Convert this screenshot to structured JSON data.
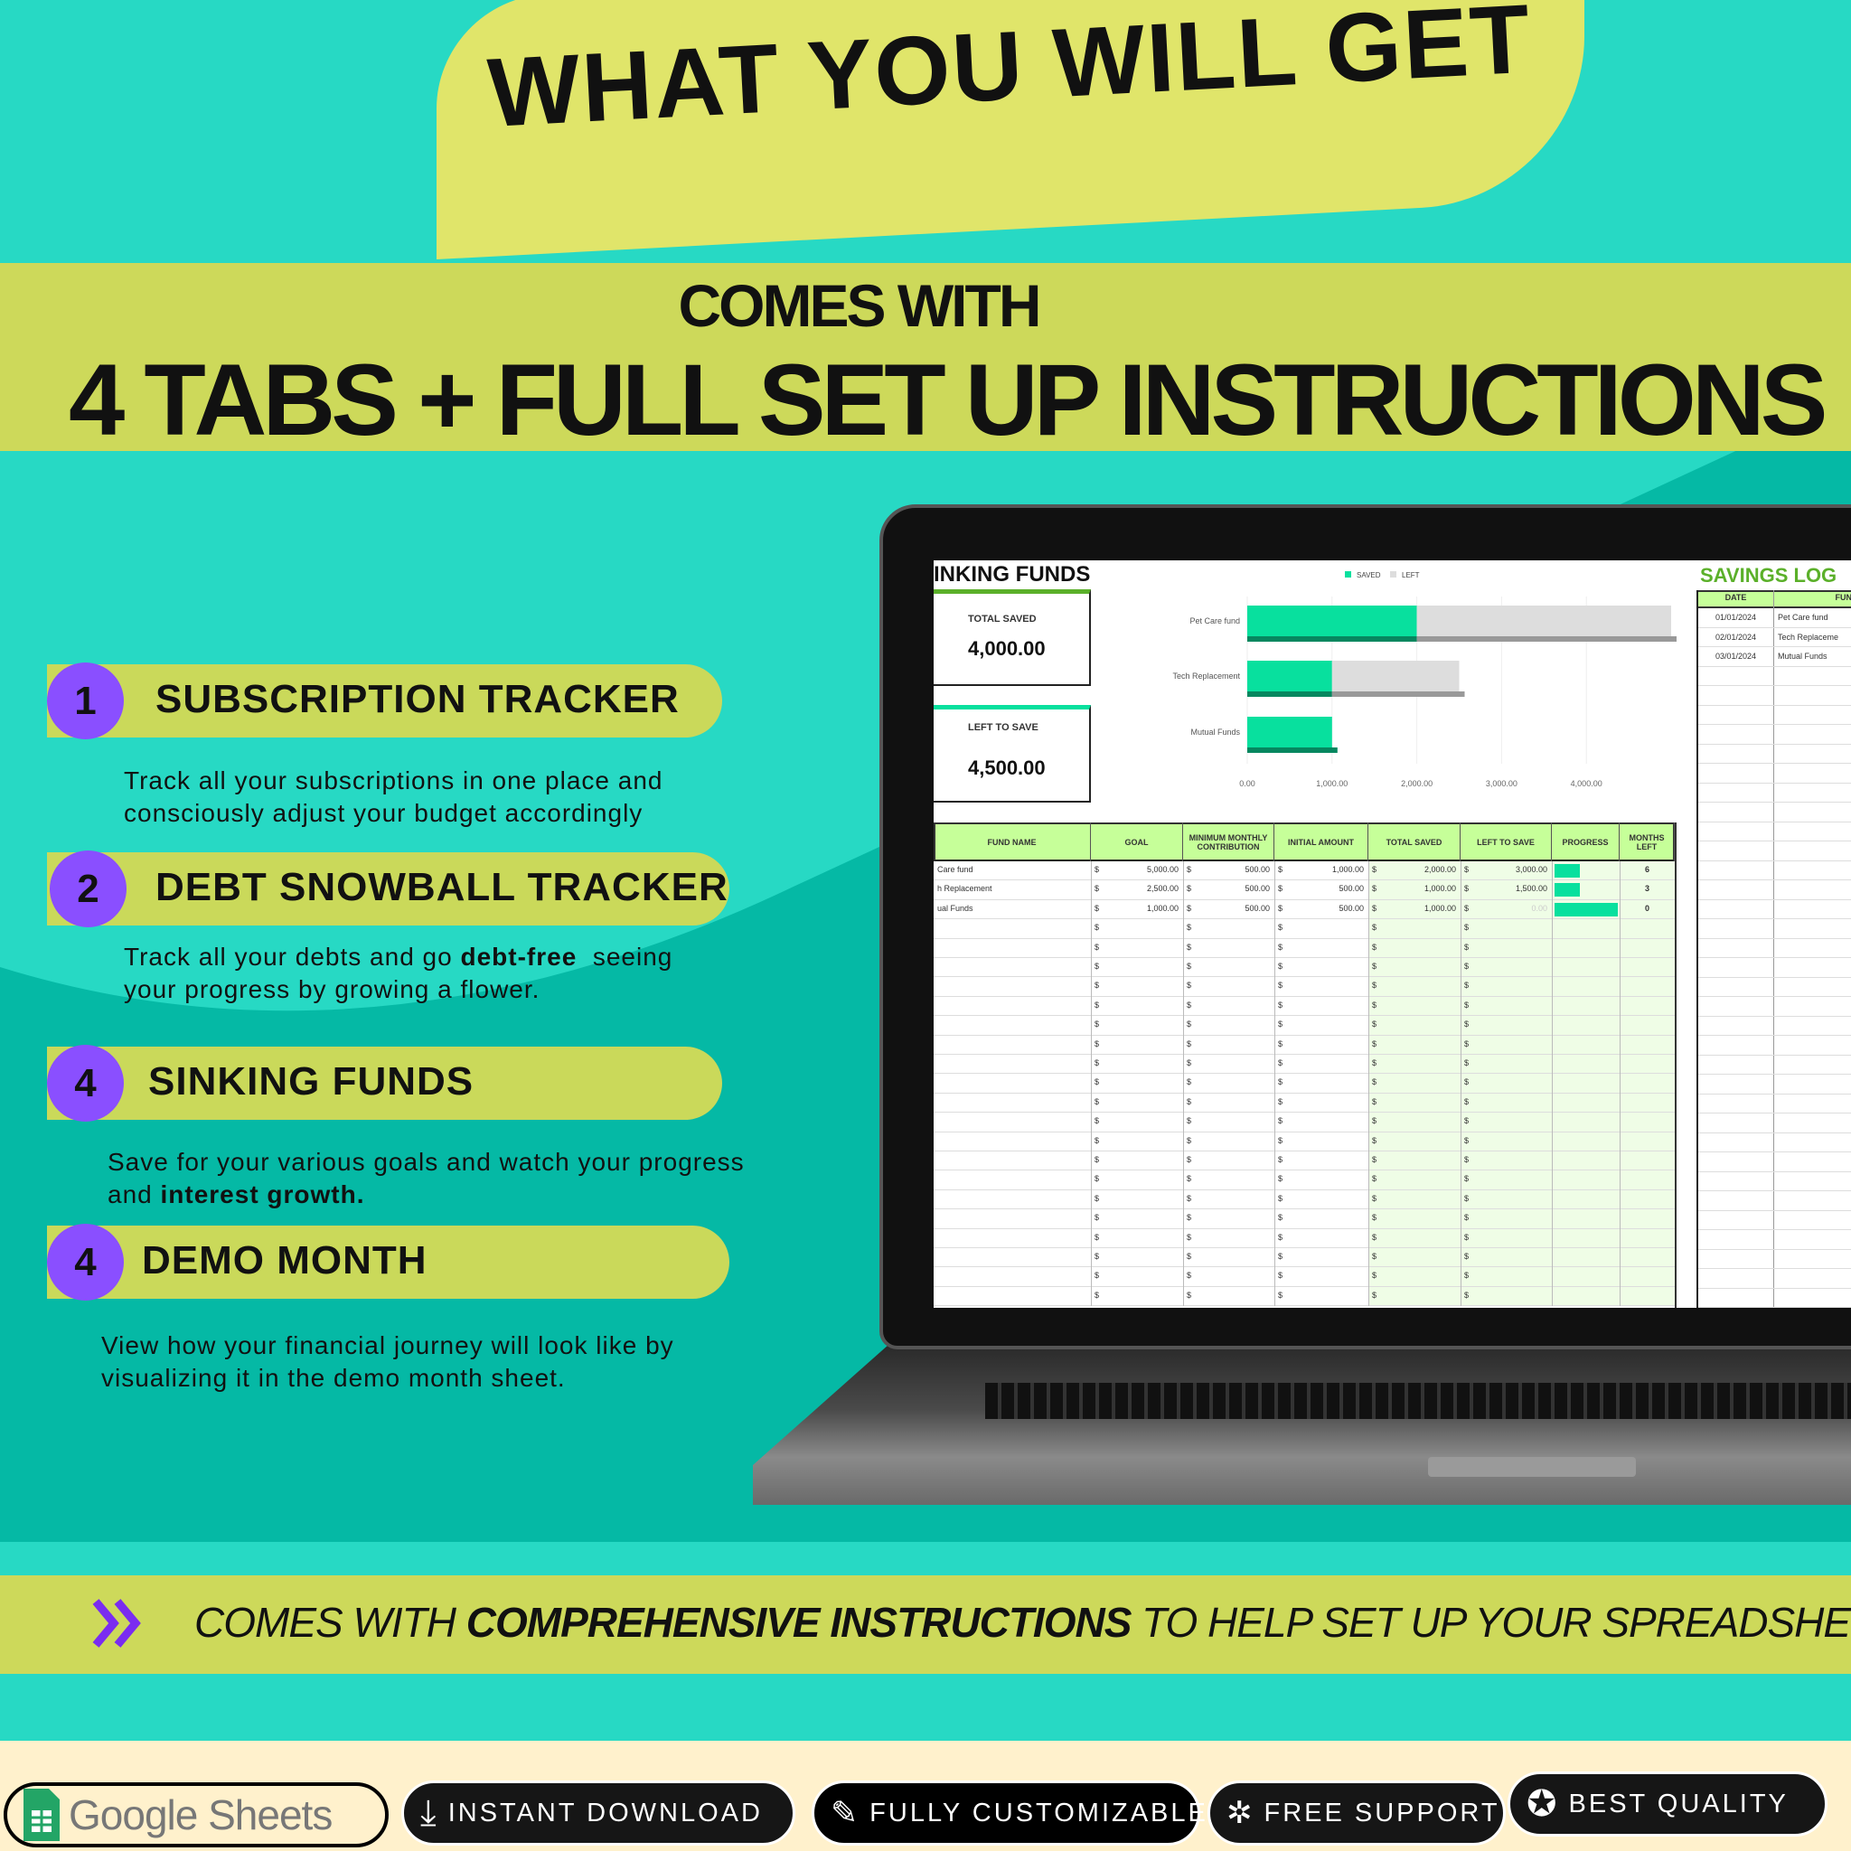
{
  "header": {
    "title": "WHAT YOU WILL GET",
    "subtitle": "COMES WITH",
    "headline": "4 TABS + FULL SET UP INSTRUCTIONS"
  },
  "features": [
    {
      "num": "1",
      "title": "SUBSCRIPTION TRACKER",
      "desc": [
        "Track all your subscriptions in one place and",
        "consciously adjust your budget accordingly"
      ]
    },
    {
      "num": "2",
      "title": "DEBT SNOWBALL TRACKER",
      "desc_pre": "Track all your debts and go ",
      "desc_bold": "debt-free",
      "desc_post": "  seeing",
      "desc2": "your progress by growing a flower."
    },
    {
      "num": "4",
      "title": "SINKING FUNDS",
      "desc": "Save for your various goals and watch your progress",
      "desc2_pre": "and ",
      "desc2_bold": "interest growth."
    },
    {
      "num": "4",
      "title": "DEMO MONTH",
      "desc": [
        "View how your financial journey will look like by",
        "visualizing it in the demo month sheet."
      ]
    }
  ],
  "sheet": {
    "title": "INKING FUNDS",
    "total_saved_label": "TOTAL SAVED",
    "total_saved": "4,000.00",
    "left_label": "LEFT TO SAVE",
    "left": "4,500.00",
    "headers": [
      "FUND NAME",
      "GOAL",
      "MINIMUM MONTHLY CONTRIBUTION",
      "INITIAL AMOUNT",
      "TOTAL SAVED",
      "LEFT TO SAVE",
      "PROGRESS",
      "MONTHS LEFT"
    ],
    "rows": [
      {
        "name": "Care fund",
        "goal": "5,000.00",
        "min": "500.00",
        "init": "1,000.00",
        "saved": "2,000.00",
        "left": "3,000.00",
        "progress": 0.4,
        "months": "6"
      },
      {
        "name": "h Replacement",
        "goal": "2,500.00",
        "min": "500.00",
        "init": "500.00",
        "saved": "1,000.00",
        "left": "1,500.00",
        "progress": 0.4,
        "months": "3"
      },
      {
        "name": "ual Funds",
        "goal": "1,000.00",
        "min": "500.00",
        "init": "500.00",
        "saved": "1,000.00",
        "left": "0.00",
        "progress": 1.0,
        "months": "0"
      }
    ],
    "currency": "$",
    "log_title": "SAVINGS LOG",
    "log_headers": [
      "DATE",
      "FUN"
    ],
    "log_rows": [
      [
        "01/01/2024",
        "Pet Care fund"
      ],
      [
        "02/01/2024",
        "Tech Replaceme"
      ],
      [
        "03/01/2024",
        "Mutual Funds"
      ]
    ]
  },
  "chart_data": {
    "type": "bar",
    "orientation": "horizontal",
    "stacked": true,
    "categories": [
      "Pet Care fund",
      "Tech Replacement",
      "Mutual Funds"
    ],
    "series": [
      {
        "name": "SAVED",
        "values": [
          2000,
          1000,
          1000
        ],
        "color": "#08e09e"
      },
      {
        "name": "LEFT",
        "values": [
          3000,
          1500,
          0
        ],
        "color": "#dddddd"
      }
    ],
    "xticks": [
      "0.00",
      "1,000.00",
      "2,000.00",
      "3,000.00",
      "4,000.00"
    ],
    "xlim": [
      0,
      5000
    ],
    "legend": "top"
  },
  "footer": {
    "pre": "COMES WITH ",
    "bold": "COMPREHENSIVE INSTRUCTIONS",
    "post": " TO HELP SET UP YOUR SPREADSHEET!"
  },
  "badges": {
    "sheets": "Google Sheets",
    "download": "INSTANT DOWNLOAD",
    "custom": "FULLY CUSTOMIZABLE",
    "support": "FREE SUPPORT",
    "quality": "BEST QUALITY"
  },
  "colors": {
    "teal": "#27d9c4",
    "yellow": "#cdd95a",
    "purple": "#8a4fff",
    "green": "#08e09e"
  }
}
